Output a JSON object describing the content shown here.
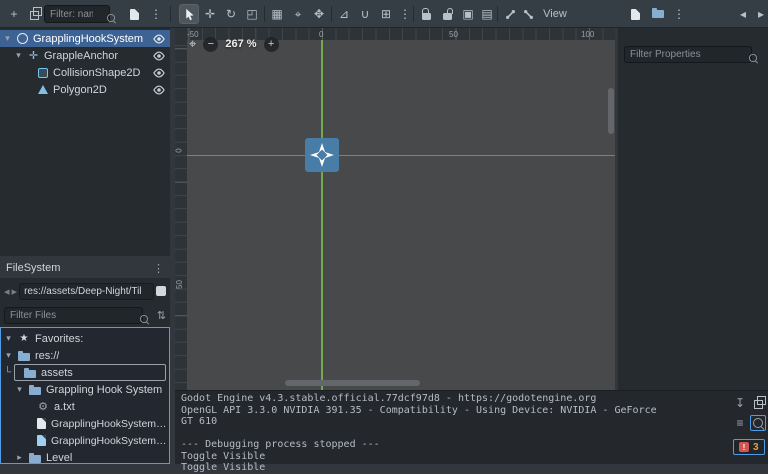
{
  "icons": {
    "add": "+",
    "dots": "⋮",
    "move": "✛",
    "rotate": "↻",
    "scale": "◰",
    "region": "▦",
    "pivot": "⌖",
    "pan": "✥",
    "ruler": "⊿",
    "snap": "∪",
    "grid": "⊞",
    "group": "▣",
    "ungroup": "▤",
    "back": "◂",
    "forward": "▸",
    "collapse": "▾",
    "expand": "▸",
    "star": "★",
    "gear": "⚙",
    "sort": "⇅",
    "save": "↧",
    "filter_lines": "≡",
    "zoom_out": "−",
    "zoom_in": "+",
    "center": "⌖",
    "guide": "└",
    "marker": "✛",
    "error": "!"
  },
  "toolbar": {
    "filter_placeholder": "Filter: name, t",
    "view_label": "View"
  },
  "scene": {
    "nodes": [
      {
        "name": "GrapplingHookSystem"
      },
      {
        "name": "GrappleAnchor"
      },
      {
        "name": "CollisionShape2D"
      },
      {
        "name": "Polygon2D"
      }
    ]
  },
  "filesystem": {
    "title": "FileSystem",
    "path": "res://assets/Deep-Night/Til",
    "filter_placeholder": "Filter Files",
    "items": [
      {
        "label": "Favorites:"
      },
      {
        "label": "res://"
      },
      {
        "label": "assets"
      },
      {
        "label": "Grappling Hook System"
      },
      {
        "label": "a.txt"
      },
      {
        "label": "GrapplingHookSystem.gd"
      },
      {
        "label": "GrapplingHookSystem.tscn"
      },
      {
        "label": "Level"
      }
    ]
  },
  "viewport": {
    "zoom_level": "267 %",
    "ruler_top": [
      "-50",
      "0",
      "50",
      "100"
    ],
    "ruler_left": [
      "0",
      "50"
    ]
  },
  "inspector": {
    "filter_placeholder": "Filter Properties"
  },
  "output": {
    "lines": [
      "Godot Engine v4.3.stable.official.77dcf97d8 - https://godotengine.org",
      "OpenGL API 3.3.0 NVIDIA 391.35 - Compatibility - Using Device: NVIDIA - GeForce",
      "GT 610",
      "",
      "--- Debugging process stopped ---",
      "Toggle Visible",
      "Toggle Visible"
    ],
    "error_count": "3"
  },
  "colors": {
    "accent": "#4f9ce8",
    "selection": "#3d6394",
    "viewport_bg": "#47494b",
    "origin_x_line": "#76a84e",
    "origin_y_line": "#b06a6a",
    "gizmo": "#477da6"
  }
}
